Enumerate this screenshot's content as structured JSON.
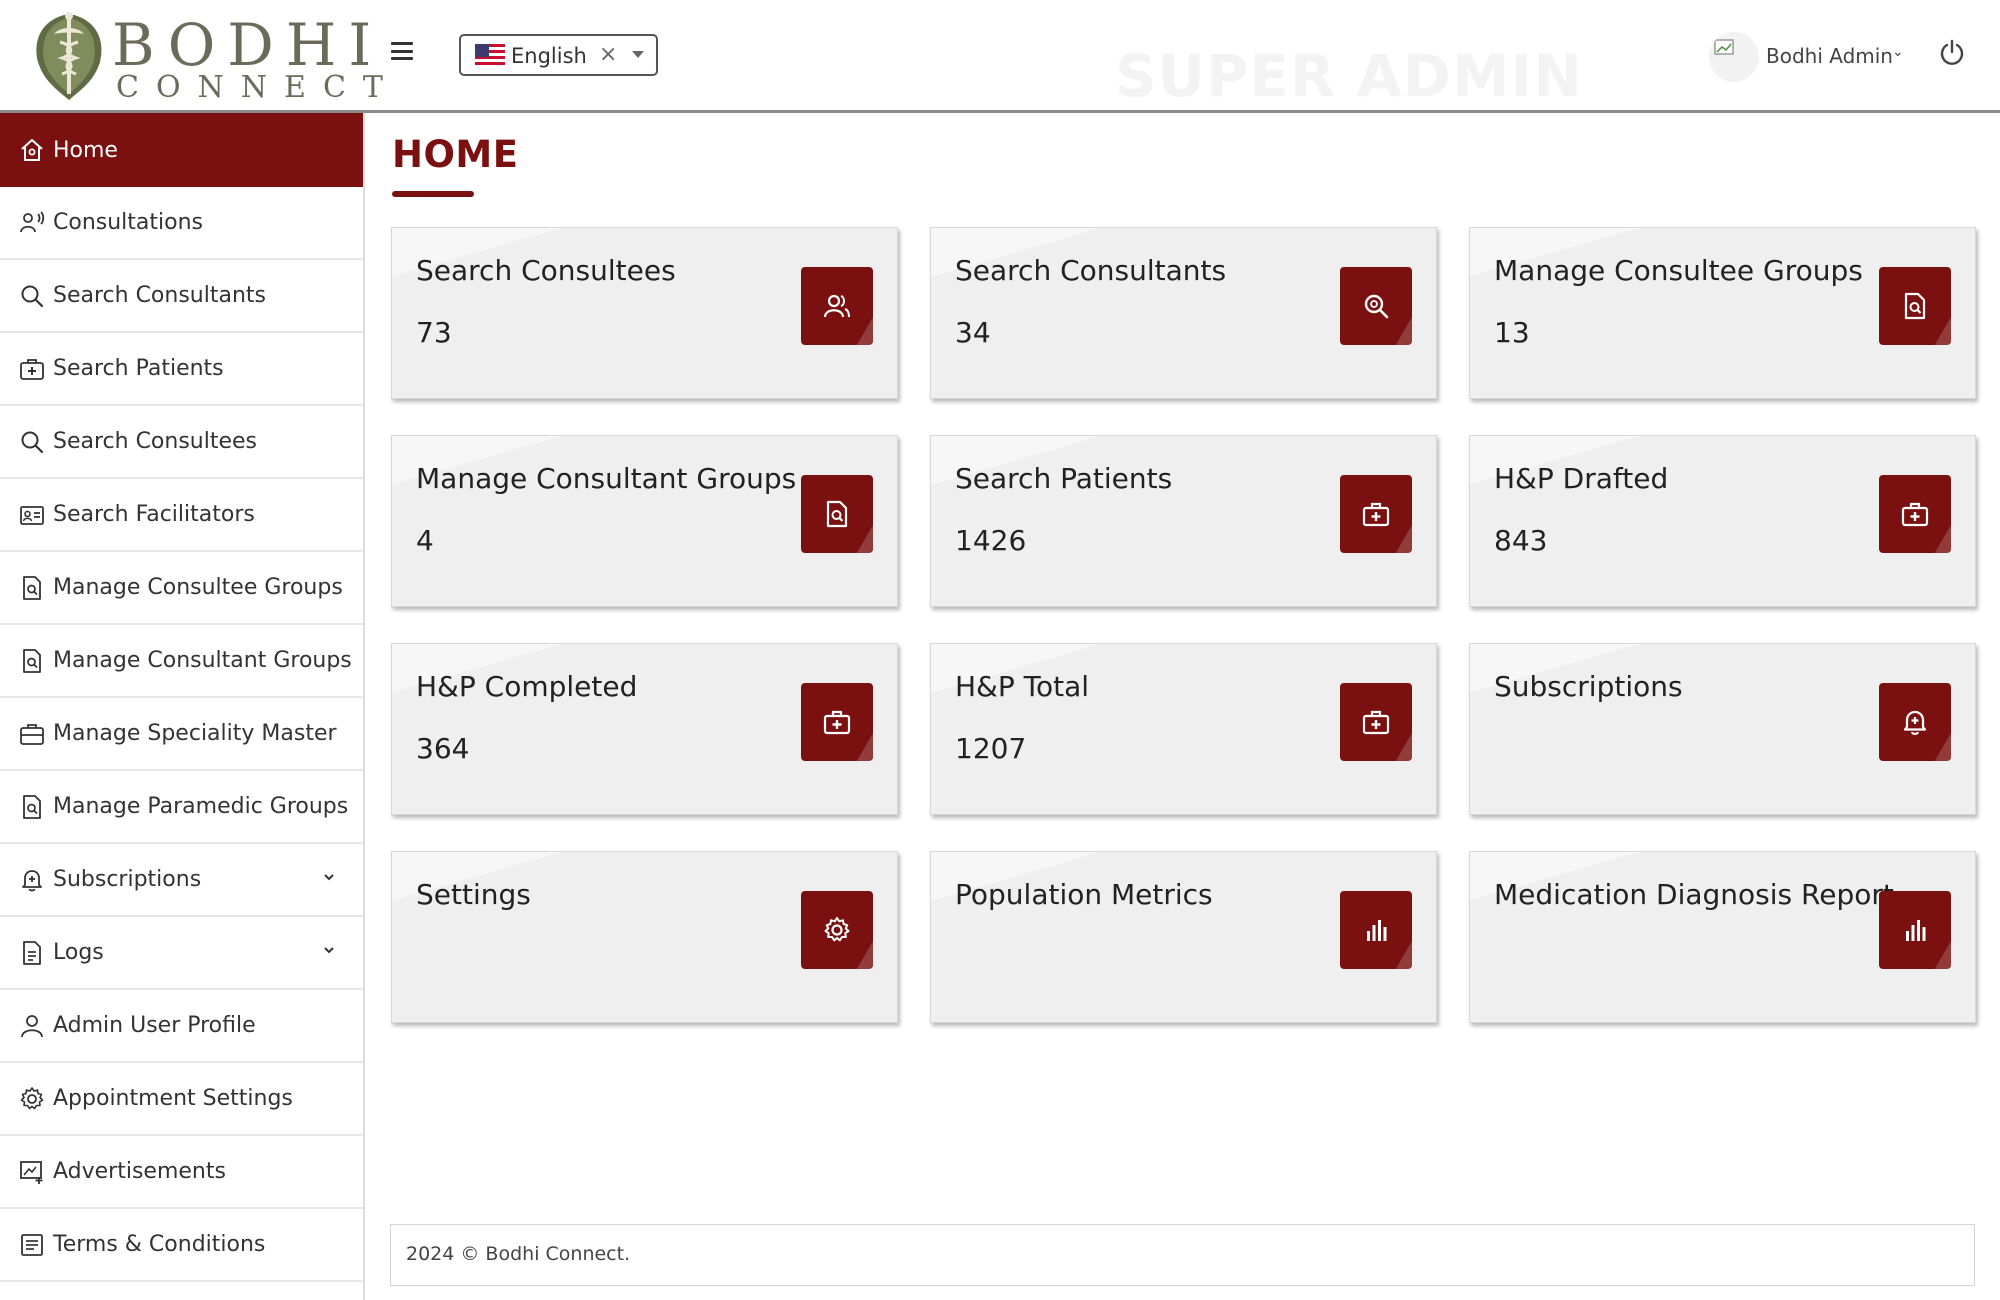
{
  "header": {
    "logo": {
      "top": "BODHI",
      "bottom": "CONNECT"
    },
    "language": {
      "selected": "English",
      "clear": "×"
    },
    "watermark": "SUPER ADMIN",
    "user": {
      "name": "Bodhi Admin",
      "caret": "⌄"
    }
  },
  "sidebar": {
    "items": [
      {
        "label": "Home",
        "icon": "home-icon",
        "active": true
      },
      {
        "label": "Consultations",
        "icon": "consultations-icon"
      },
      {
        "label": "Search Consultants",
        "icon": "search-icon"
      },
      {
        "label": "Search Patients",
        "icon": "medical-kit-icon"
      },
      {
        "label": "Search Consultees",
        "icon": "search-icon"
      },
      {
        "label": "Search Facilitators",
        "icon": "id-card-icon"
      },
      {
        "label": "Manage Consultee Groups",
        "icon": "document-search-icon"
      },
      {
        "label": "Manage Consultant Groups",
        "icon": "document-search-icon"
      },
      {
        "label": "Manage Speciality Master",
        "icon": "medical-kit-icon"
      },
      {
        "label": "Manage Paramedic Groups",
        "icon": "document-search-icon"
      },
      {
        "label": "Subscriptions",
        "icon": "bell-plus-icon",
        "expandable": true
      },
      {
        "label": "Logs",
        "icon": "file-icon",
        "expandable": true
      },
      {
        "label": "Admin User Profile",
        "icon": "user-icon"
      },
      {
        "label": "Appointment Settings",
        "icon": "gear-icon"
      },
      {
        "label": "Advertisements",
        "icon": "advert-icon"
      },
      {
        "label": "Terms & Conditions",
        "icon": "list-icon"
      }
    ]
  },
  "main": {
    "title": "HOME",
    "cards": [
      {
        "title": "Search Consultees",
        "value": "73",
        "icon": "users-icon"
      },
      {
        "title": "Search Consultants",
        "value": "34",
        "icon": "search-icon"
      },
      {
        "title": "Manage Consultee Groups",
        "value": "13",
        "icon": "document-search-icon"
      },
      {
        "title": "Manage Consultant Groups",
        "value": "4",
        "icon": "document-search-icon"
      },
      {
        "title": "Search Patients",
        "value": "1426",
        "icon": "medical-kit-icon"
      },
      {
        "title": "H&P Drafted",
        "value": "843",
        "icon": "medical-kit-icon"
      },
      {
        "title": "H&P Completed",
        "value": "364",
        "icon": "medical-kit-icon"
      },
      {
        "title": "H&P Total",
        "value": "1207",
        "icon": "medical-kit-icon"
      },
      {
        "title": "Subscriptions",
        "value": "",
        "icon": "bell-plus-icon"
      },
      {
        "title": "Settings",
        "value": "",
        "icon": "gear-icon"
      },
      {
        "title": "Population Metrics",
        "value": "",
        "icon": "bar-chart-icon"
      },
      {
        "title": "Medication Diagnosis Report",
        "value": "",
        "icon": "bar-chart-icon"
      }
    ]
  },
  "footer": {
    "text": "2024 © Bodhi Connect."
  },
  "colors": {
    "brand": "#7b1010",
    "card_bg": "#f7f7f7",
    "text": "#222222"
  }
}
